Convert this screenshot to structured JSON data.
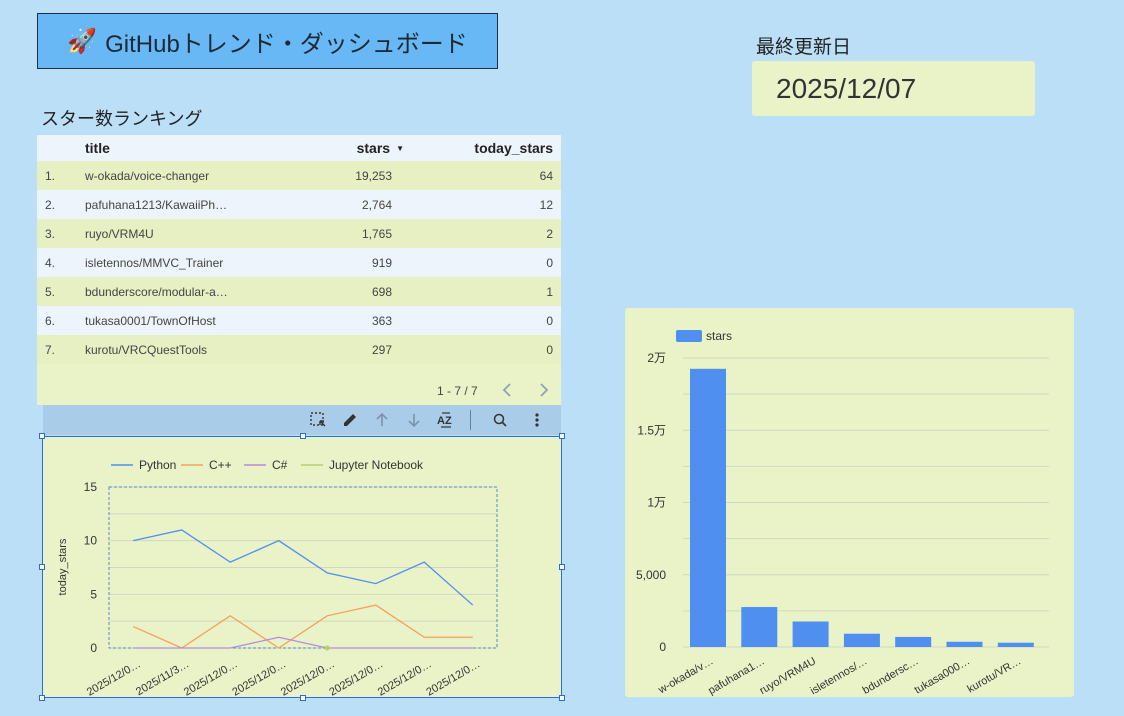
{
  "header": {
    "title_icon": "rocket-icon",
    "title": "GitHubトレンド・ダッシュボード",
    "updated_label": "最終更新日",
    "updated_value": "2025/12/07"
  },
  "ranking": {
    "title": "スター数ランキング",
    "columns": {
      "title": "title",
      "stars": "stars",
      "today": "today_stars"
    },
    "rows": [
      {
        "idx": "1.",
        "title": "w-okada/voice-changer",
        "stars": "19,253",
        "today": "64"
      },
      {
        "idx": "2.",
        "title": "pafuhana1213/KawaiiPh…",
        "stars": "2,764",
        "today": "12"
      },
      {
        "idx": "3.",
        "title": "ruyo/VRM4U",
        "stars": "1,765",
        "today": "2"
      },
      {
        "idx": "4.",
        "title": "isletennos/MMVC_Trainer",
        "stars": "919",
        "today": "0"
      },
      {
        "idx": "5.",
        "title": "bdunderscore/modular-a…",
        "stars": "698",
        "today": "1"
      },
      {
        "idx": "6.",
        "title": "tukasa0001/TownOfHost",
        "stars": "363",
        "today": "0"
      },
      {
        "idx": "7.",
        "title": "kurotu/VRCQuestTools",
        "stars": "297",
        "today": "0"
      }
    ],
    "pager": "1 - 7 / 7"
  },
  "toolbar": {
    "icons": [
      "select-area-icon",
      "edit-icon",
      "arrow-up-icon",
      "arrow-down-icon",
      "sort-az-icon",
      "explore-icon",
      "more-vert-icon"
    ]
  },
  "colors": {
    "background": "#bcdff8",
    "panel": "#eaf3c8",
    "bar": "#4f8ff0",
    "python": "#4f8ff0",
    "cpp": "#f4a15d",
    "csharp": "#b48be3",
    "jupyter": "#b5cf6b"
  },
  "chart_data": [
    {
      "type": "line",
      "ylabel": "today_stars",
      "ylim": [
        0,
        15
      ],
      "yticks": [
        "0",
        "5",
        "10",
        "15"
      ],
      "categories": [
        "2025/12/0…",
        "2025/11/3…",
        "2025/12/0…",
        "2025/12/0…",
        "2025/12/0…",
        "2025/12/0…",
        "2025/12/0…",
        "2025/12/0…"
      ],
      "series": [
        {
          "name": "Python",
          "color": "#4f8ff0",
          "values": [
            10,
            11,
            8,
            10,
            7,
            6,
            8,
            4
          ]
        },
        {
          "name": "C++",
          "color": "#f4a15d",
          "values": [
            2,
            0,
            3,
            0,
            3,
            4,
            1,
            1
          ]
        },
        {
          "name": "C#",
          "color": "#b48be3",
          "values": [
            0,
            0,
            0,
            1,
            0,
            0,
            0,
            0
          ]
        },
        {
          "name": "Jupyter Notebook",
          "color": "#b5cf6b",
          "values": [
            null,
            null,
            null,
            null,
            0,
            null,
            null,
            null
          ]
        }
      ]
    },
    {
      "type": "bar",
      "legend": "stars",
      "categories": [
        "w-okada/v…",
        "pafuhana1…",
        "ruyo/VRM4U",
        "isletennos/…",
        "bdundersc…",
        "tukasa000…",
        "kurotu/VR…"
      ],
      "values": [
        19253,
        2764,
        1765,
        919,
        698,
        363,
        297
      ],
      "ylim": [
        0,
        20000
      ],
      "yticks": [
        "0",
        "5,000",
        "1万",
        "1.5万",
        "2万"
      ]
    }
  ]
}
